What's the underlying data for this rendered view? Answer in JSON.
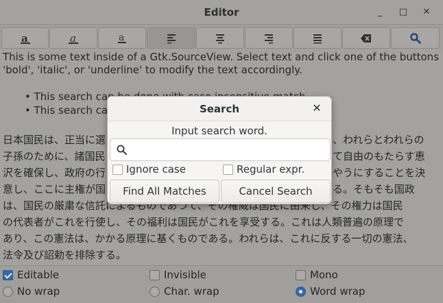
{
  "window": {
    "title": "Editor"
  },
  "window_controls": {
    "minimize": "_",
    "maximize": "□",
    "close": "✕"
  },
  "toolbar": {
    "buttons": [
      {
        "icon": "bold-icon"
      },
      {
        "icon": "italic-icon"
      },
      {
        "icon": "underline-icon"
      },
      {
        "icon": "align-left-icon",
        "active": true
      },
      {
        "icon": "align-center-icon"
      },
      {
        "icon": "align-right-icon"
      },
      {
        "icon": "align-justify-icon"
      },
      {
        "icon": "backspace-icon"
      },
      {
        "icon": "search-icon"
      }
    ]
  },
  "editor": {
    "line1": "This is some text inside of a Gtk.SourceView. Select text and click one of the buttons",
    "line2": "'bold', 'italic', or 'underline' to modify the text accordingly.",
    "bullet1": "• This search can be done with case insensitive match",
    "bullet2": "• This search can",
    "jp1a": "日本国民は、正当に選",
    "jp1b": "、われらとわれらの",
    "jp2a": "子孫のために、諸国民",
    "jp2b": "て自由のもたらす恵",
    "jp3a": "沢を確保し、政府の行",
    "jp3b": "やうにすることを決",
    "jp4a": "意し、ここに主権が国",
    "jp4b": "る。そもそも国政",
    "jp5": "は、国民の厳粛な信託によるものであつて、その権威は国民に由来し、その権力は国民",
    "jp6": "の代表者がこれを行使し、その福利は国民がこれを享受する。これは人類普遍の原理で",
    "jp7": "あり、この憲法は、かかる原理に基くものである。われらは、これに反する一切の憲法、",
    "jp8": "法令及び詔勅を排除する。"
  },
  "options": {
    "editable": "Editable",
    "invisible": "Invisible",
    "mono": "Mono",
    "no_wrap": "No wrap",
    "char_wrap": "Char. wrap",
    "word_wrap": "Word wrap"
  },
  "dialog": {
    "title": "Search",
    "prompt": "Input search word.",
    "search_value": "",
    "ignore_case": "Ignore case",
    "regular_expr": "Regular expr.",
    "find_all": "Find All Matches",
    "cancel": "Cancel Search"
  }
}
